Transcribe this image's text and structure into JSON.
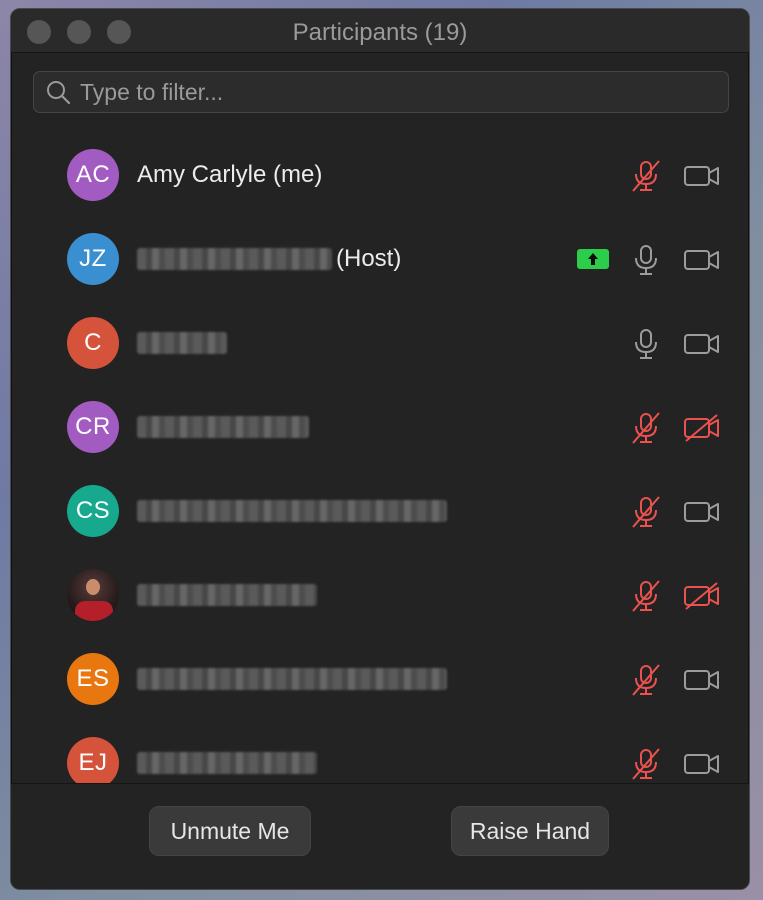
{
  "window": {
    "title": "Participants (19)"
  },
  "search": {
    "placeholder": "Type to filter..."
  },
  "participants": [
    {
      "initials": "AC",
      "name": "Amy Carlyle (me)",
      "avatar_color": "#a25cc1",
      "blurred": false,
      "suffix": "",
      "mic": "muted",
      "camera": "off-plain",
      "sharing": false
    },
    {
      "initials": "JZ",
      "name": "",
      "avatar_color": "#3a8fd0",
      "blurred": true,
      "suffix": "(Host)",
      "mic": "on",
      "camera": "off-plain",
      "sharing": true
    },
    {
      "initials": "C",
      "name": "",
      "avatar_color": "#d4533a",
      "blurred": true,
      "suffix": "",
      "mic": "on",
      "camera": "off-plain",
      "sharing": false
    },
    {
      "initials": "CR",
      "name": "",
      "avatar_color": "#a25cc1",
      "blurred": true,
      "suffix": "",
      "mic": "muted",
      "camera": "stopped",
      "sharing": false
    },
    {
      "initials": "CS",
      "name": "",
      "avatar_color": "#16a98e",
      "blurred": true,
      "suffix": "",
      "mic": "muted",
      "camera": "off-plain",
      "sharing": false
    },
    {
      "initials": "",
      "name": "",
      "avatar_color": "#2a1e1e",
      "blurred": true,
      "suffix": "",
      "mic": "muted",
      "camera": "stopped",
      "sharing": false,
      "photo": true
    },
    {
      "initials": "ES",
      "name": "",
      "avatar_color": "#e8770f",
      "blurred": true,
      "suffix": "",
      "mic": "muted",
      "camera": "off-plain",
      "sharing": false
    },
    {
      "initials": "EJ",
      "name": "",
      "avatar_color": "#d4533a",
      "blurred": true,
      "suffix": "",
      "mic": "muted",
      "camera": "off-plain",
      "sharing": false
    }
  ],
  "footer": {
    "unmute_label": "Unmute Me",
    "raise_hand_label": "Raise Hand"
  },
  "colors": {
    "muted_red": "#e9524f",
    "share_green": "#2ccd4a",
    "icon_gray": "#9c9c9c"
  }
}
